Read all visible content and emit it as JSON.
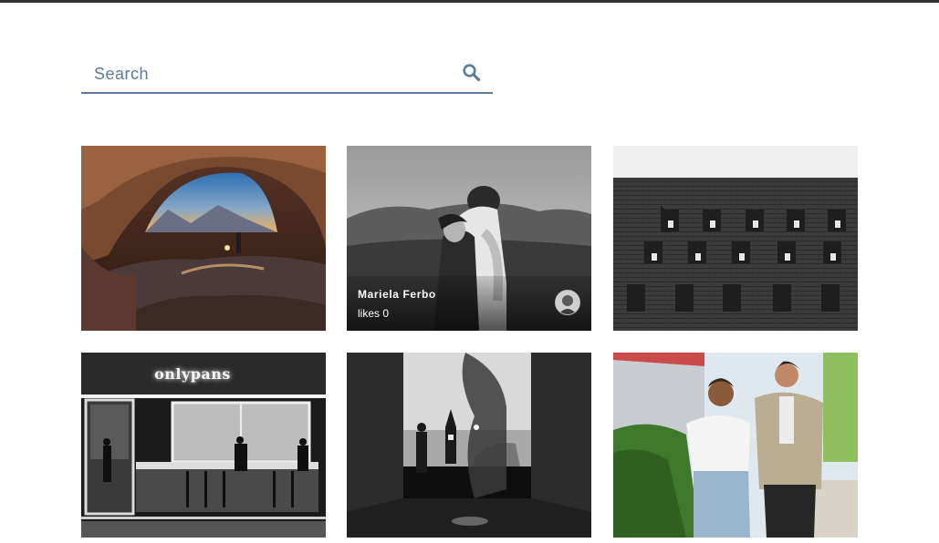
{
  "colors": {
    "accent": "#5b7b9a",
    "topbar": "#333333"
  },
  "search": {
    "placeholder": "Search",
    "value": "",
    "icon": "search-icon"
  },
  "gallery": {
    "photos": [
      {
        "subject": "desert-arch",
        "hover": false
      },
      {
        "subject": "couple-embrace-bw",
        "hover": true,
        "author": "Mariela Ferbo",
        "likes": "likes 0"
      },
      {
        "subject": "roof-dormer-windows-bw",
        "hover": false
      },
      {
        "subject": "storefront-night-bw",
        "hover": false,
        "sign": "onlypans"
      },
      {
        "subject": "big-ben-alley-bw",
        "hover": false
      },
      {
        "subject": "two-women-smiling",
        "hover": false
      }
    ]
  }
}
